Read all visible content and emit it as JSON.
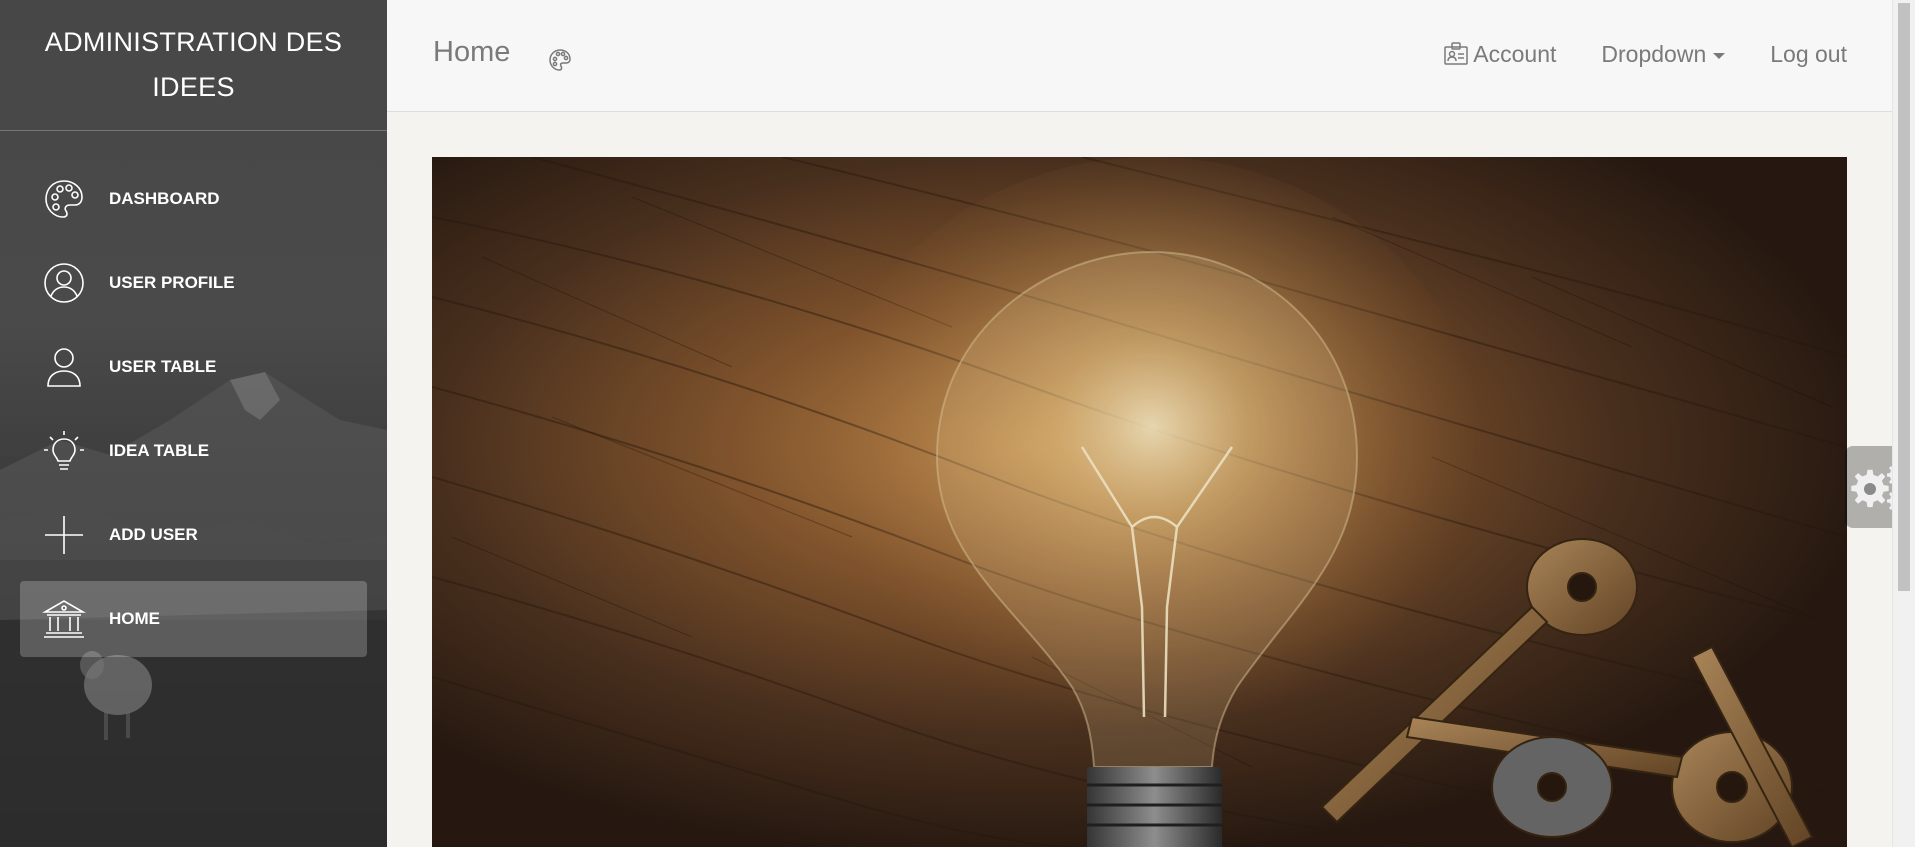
{
  "sidebar": {
    "brand": "ADMINISTRATION DES IDEES",
    "items": [
      {
        "label": "DASHBOARD",
        "icon": "palette-icon",
        "active": false
      },
      {
        "label": "USER PROFILE",
        "icon": "user-circle-icon",
        "active": false
      },
      {
        "label": "USER TABLE",
        "icon": "user-icon",
        "active": false
      },
      {
        "label": "IDEA TABLE",
        "icon": "lightbulb-icon",
        "active": false
      },
      {
        "label": "ADD USER",
        "icon": "plus-icon",
        "active": false
      },
      {
        "label": "HOME",
        "icon": "bank-icon",
        "active": true
      }
    ]
  },
  "navbar": {
    "title": "Home",
    "title_icon": "palette-icon",
    "links": {
      "account": "Account",
      "dropdown": "Dropdown",
      "logout": "Log out"
    }
  },
  "hero": {
    "description_icon": "lightbulb-keys-photo"
  },
  "fixed_plugin": {
    "icon": "gears-icon"
  },
  "colors": {
    "sidebar_bg": "#474747",
    "navbar_bg": "#f7f7f8",
    "text_muted": "#7a7a7a",
    "content_bg": "#f4f3ef"
  }
}
